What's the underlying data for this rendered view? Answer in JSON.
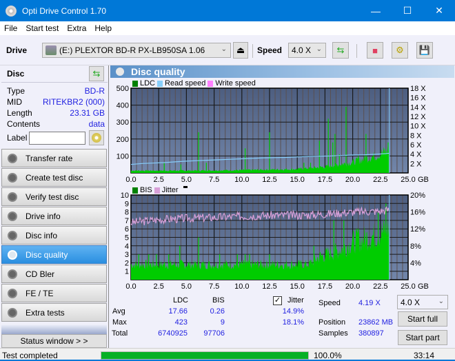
{
  "window": {
    "title": "Opti Drive Control 1.70",
    "minimize": "—",
    "maximize": "☐",
    "close": "✕"
  },
  "menu": [
    "File",
    "Start test",
    "Extra",
    "Help"
  ],
  "toolbar": {
    "drive_label": "Drive",
    "drive_value": "(E:)  PLEXTOR BD-R  PX-LB950SA 1.06",
    "speed_label": "Speed",
    "speed_value": "4.0 X",
    "icons": [
      "eject-icon",
      "refresh-icon",
      "erase-icon",
      "settings-icon",
      "save-icon"
    ]
  },
  "disc": {
    "header": "Disc",
    "rows": [
      {
        "label": "Type",
        "value": "BD-R"
      },
      {
        "label": "MID",
        "value": "RITEKBR2 (000)"
      },
      {
        "label": "Length",
        "value": "23.31 GB"
      },
      {
        "label": "Contents",
        "value": "data"
      }
    ],
    "label_label": "Label",
    "label_value": ""
  },
  "nav": [
    {
      "label": "Transfer rate",
      "active": false
    },
    {
      "label": "Create test disc",
      "active": false
    },
    {
      "label": "Verify test disc",
      "active": false
    },
    {
      "label": "Drive info",
      "active": false
    },
    {
      "label": "Disc info",
      "active": false
    },
    {
      "label": "Disc quality",
      "active": true
    },
    {
      "label": "CD Bler",
      "active": false
    },
    {
      "label": "FE / TE",
      "active": false
    },
    {
      "label": "Extra tests",
      "active": false
    }
  ],
  "status_window_button": "Status window > >",
  "main": {
    "title": "Disc quality",
    "legend_top": [
      {
        "label": "LDC",
        "color": "#008000"
      },
      {
        "label": "Read speed",
        "color": "#87cefa"
      },
      {
        "label": "Write speed",
        "color": "#ff80ff"
      }
    ],
    "legend_bottom": [
      {
        "label": "BIS",
        "color": "#008000"
      },
      {
        "label": "Jitter",
        "color": "#d8a0d8"
      }
    ]
  },
  "chart_data": [
    {
      "type": "bar",
      "title": "LDC / Read speed",
      "xlabel": "GB",
      "xlim": [
        0,
        25
      ],
      "x_ticks": [
        "0.0",
        "2.5",
        "5.0",
        "7.5",
        "10.0",
        "12.5",
        "15.0",
        "17.5",
        "20.0",
        "22.5",
        "25.0"
      ],
      "ylim_left": [
        0,
        500
      ],
      "y_ticks_left": [
        "500",
        "400",
        "300",
        "200",
        "100"
      ],
      "ylim_right": [
        0,
        18
      ],
      "y_ticks_right": [
        "18 X",
        "16 X",
        "14 X",
        "12 X",
        "10 X",
        "8 X",
        "6 X",
        "4 X",
        "2 X"
      ],
      "series": [
        {
          "name": "LDC",
          "color": "#00cc00",
          "baseline": [
            [
              0,
              15
            ],
            [
              5,
              15
            ],
            [
              10,
              18
            ],
            [
              12.5,
              22
            ],
            [
              15,
              25
            ],
            [
              17.5,
              40
            ],
            [
              20,
              70
            ],
            [
              22,
              110
            ],
            [
              23.3,
              150
            ]
          ],
          "spikes": [
            [
              3.0,
              60
            ],
            [
              4.5,
              50
            ],
            [
              6.1,
              240
            ],
            [
              6.8,
              60
            ],
            [
              10.3,
              145
            ],
            [
              12.5,
              240
            ],
            [
              15.6,
              60
            ],
            [
              16.2,
              60
            ],
            [
              17,
              190
            ],
            [
              17.8,
              320
            ],
            [
              18.2,
              180
            ],
            [
              18.4,
              230
            ],
            [
              18.8,
              110
            ],
            [
              19.4,
              390
            ],
            [
              20.5,
              100
            ],
            [
              21.2,
              230
            ],
            [
              23.2,
              180
            ]
          ]
        },
        {
          "name": "Read speed",
          "color": "#87cefa",
          "x": [
            0,
            1,
            2,
            3,
            4,
            5,
            6,
            7,
            8,
            9,
            10,
            11,
            12,
            13,
            14,
            15,
            16,
            17,
            18,
            19,
            20,
            21,
            22,
            23,
            23.3
          ],
          "y": [
            1.8,
            2.0,
            2.1,
            2.2,
            2.35,
            2.5,
            2.6,
            2.7,
            2.8,
            2.9,
            3.0,
            3.1,
            3.2,
            3.25,
            3.3,
            3.4,
            3.5,
            3.55,
            3.6,
            3.7,
            3.8,
            3.85,
            3.95,
            4.1,
            4.19
          ]
        }
      ],
      "max_marker_x": 23.3
    },
    {
      "type": "bar",
      "title": "BIS / Jitter",
      "xlabel": "GB",
      "xlim": [
        0,
        25
      ],
      "x_ticks": [
        "0.0",
        "2.5",
        "5.0",
        "7.5",
        "10.0",
        "12.5",
        "15.0",
        "17.5",
        "20.0",
        "22.5",
        "25.0"
      ],
      "ylim_left": [
        0,
        10
      ],
      "y_ticks_left": [
        "10",
        "9",
        "8",
        "7",
        "6",
        "5",
        "4",
        "3",
        "2",
        "1"
      ],
      "ylim_right": [
        0,
        20
      ],
      "y_ticks_right": [
        "20%",
        "16%",
        "12%",
        "8%",
        "4%"
      ],
      "series": [
        {
          "name": "BIS",
          "color": "#00cc00",
          "baseline": [
            [
              0,
              2
            ],
            [
              12.5,
              2
            ],
            [
              16,
              2
            ],
            [
              17,
              3
            ],
            [
              19,
              4
            ],
            [
              20,
              5
            ],
            [
              22.5,
              6
            ],
            [
              23.3,
              7
            ]
          ],
          "spikes": [
            [
              0.7,
              3
            ],
            [
              1.6,
              3
            ],
            [
              2.3,
              3
            ],
            [
              3.4,
              3
            ],
            [
              4.4,
              4
            ],
            [
              6.1,
              5
            ],
            [
              8,
              3
            ],
            [
              9.6,
              3
            ],
            [
              10.3,
              3
            ],
            [
              10.7,
              3
            ],
            [
              12.5,
              3
            ],
            [
              16.5,
              4
            ],
            [
              18.3,
              7
            ],
            [
              19.2,
              7
            ],
            [
              20.5,
              6
            ],
            [
              22.3,
              8
            ],
            [
              23.0,
              9
            ]
          ]
        },
        {
          "name": "Jitter",
          "color": "#d8a0d8",
          "unit": "%",
          "x": [
            0,
            2.5,
            5,
            7.5,
            10,
            12.5,
            15,
            17.5,
            20,
            22.5,
            23.3
          ],
          "y": [
            13.5,
            14.2,
            14.5,
            14.7,
            15,
            15.2,
            15.2,
            15.5,
            16,
            16.2,
            16.5
          ]
        }
      ],
      "max_marker_x": 23.3
    }
  ],
  "stats": {
    "col_ldc": "LDC",
    "col_bis": "BIS",
    "jitter_label": "Jitter",
    "jitter_checked": true,
    "rows": [
      {
        "label": "Avg",
        "ldc": "17.66",
        "bis": "0.26",
        "jitter": "14.9%"
      },
      {
        "label": "Max",
        "ldc": "423",
        "bis": "9",
        "jitter": "18.1%"
      },
      {
        "label": "Total",
        "ldc": "6740925",
        "bis": "97706",
        "jitter": ""
      }
    ],
    "speed_label": "Speed",
    "speed_value": "4.19 X",
    "position_label": "Position",
    "position_value": "23862 MB",
    "samples_label": "Samples",
    "samples_value": "380897",
    "speed_select": "4.0 X",
    "start_full": "Start full",
    "start_part": "Start part"
  },
  "statusbar": {
    "text": "Test completed",
    "progress_percent": 100.0,
    "progress_label": "100.0%",
    "time": "33:14"
  }
}
